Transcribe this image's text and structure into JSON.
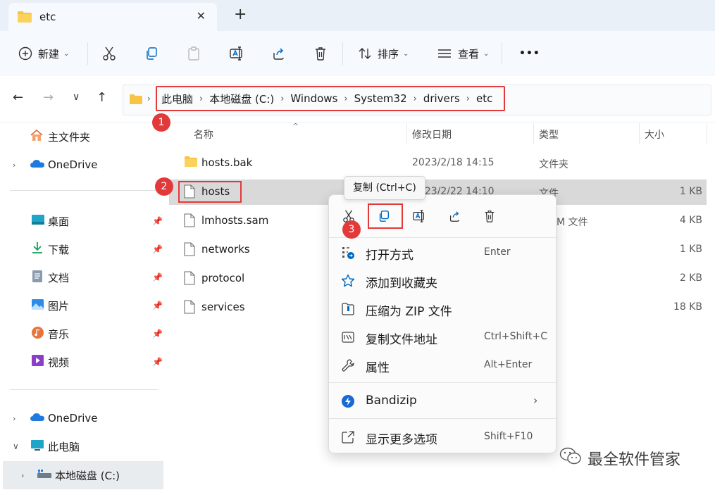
{
  "tab": {
    "title": "etc",
    "close": "✕",
    "new": "+"
  },
  "toolbar": {
    "new_label": "新建",
    "sort_label": "排序",
    "view_label": "查看",
    "more_label": "•••"
  },
  "breadcrumb": [
    "此电脑",
    "本地磁盘 (C:)",
    "Windows",
    "System32",
    "drivers",
    "etc"
  ],
  "badges": [
    "1",
    "2",
    "3"
  ],
  "sidebar": {
    "home": "主文件夹",
    "onedrive_top": "OneDrive",
    "pinned": [
      {
        "label": "桌面",
        "icon": "desktop-icon"
      },
      {
        "label": "下载",
        "icon": "download-icon"
      },
      {
        "label": "文档",
        "icon": "document-icon"
      },
      {
        "label": "图片",
        "icon": "pictures-icon"
      },
      {
        "label": "音乐",
        "icon": "music-icon"
      },
      {
        "label": "视频",
        "icon": "video-icon"
      }
    ],
    "onedrive_bottom": "OneDrive",
    "thispc": "此电脑",
    "local_disk": "本地磁盘 (C:)"
  },
  "columns": {
    "name": "名称",
    "date": "修改日期",
    "type": "类型",
    "size": "大小"
  },
  "files": [
    {
      "name": "hosts.bak",
      "date": "2023/2/18 14:15",
      "type": "文件夹",
      "size": "",
      "icon": "folder-icon"
    },
    {
      "name": "hosts",
      "date": "2023/2/22 14:10",
      "type": "文件",
      "size": "1 KB",
      "icon": "file-icon"
    },
    {
      "name": "lmhosts.sam",
      "date": "",
      "type": "M 文件",
      "size": "4 KB",
      "icon": "file-icon"
    },
    {
      "name": "networks",
      "date": "",
      "type": "",
      "size": "1 KB",
      "icon": "file-icon"
    },
    {
      "name": "protocol",
      "date": "",
      "type": "",
      "size": "2 KB",
      "icon": "file-icon"
    },
    {
      "name": "services",
      "date": "",
      "type": "",
      "size": "18 KB",
      "icon": "file-icon"
    }
  ],
  "tooltip": "复制 (Ctrl+C)",
  "context_menu": {
    "items": [
      {
        "label": "打开方式",
        "shortcut": "Enter",
        "icon": "open-with-icon"
      },
      {
        "label": "添加到收藏夹",
        "shortcut": "",
        "icon": "star-icon"
      },
      {
        "label": "压缩为 ZIP 文件",
        "shortcut": "",
        "icon": "zip-icon"
      },
      {
        "label": "复制文件地址",
        "shortcut": "Ctrl+Shift+C",
        "icon": "copy-path-icon"
      },
      {
        "label": "属性",
        "shortcut": "Alt+Enter",
        "icon": "wrench-icon"
      }
    ],
    "bandizip": "Bandizip",
    "more": {
      "label": "显示更多选项",
      "shortcut": "Shift+F10"
    }
  },
  "watermark": "最全软件管家",
  "colors": {
    "accent": "#0067c0",
    "annotation_red": "#e23a3a",
    "folder_yellow": "#f8c445"
  }
}
